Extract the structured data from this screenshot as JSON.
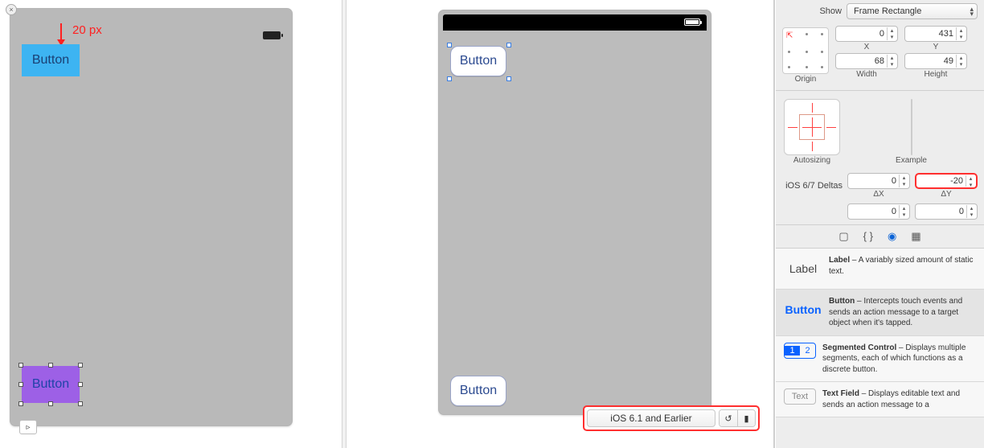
{
  "left_canvas": {
    "annotation_text": "20 px",
    "button_top_label": "Button",
    "button_bottom_label": "Button",
    "segue_glyph": "▹"
  },
  "mid_canvas": {
    "button_top_label": "Button",
    "button_bottom_label": "Button"
  },
  "bottom_bar": {
    "label": "iOS 6.1 and Earlier",
    "seg_left_glyph": "↺",
    "seg_right_glyph": "▮"
  },
  "inspector": {
    "show_label": "Show",
    "show_value": "Frame Rectangle",
    "origin_label": "Origin",
    "coords": {
      "x_label": "X",
      "x_value": "0",
      "y_label": "Y",
      "y_value": "431",
      "w_label": "Width",
      "w_value": "68",
      "h_label": "Height",
      "h_value": "49"
    },
    "autosizing_label": "Autosizing",
    "example_label": "Example",
    "deltas_label": "iOS 6/7 Deltas",
    "deltas": {
      "dx_label": "ΔX",
      "dx_value": "0",
      "dy_label": "ΔY",
      "dy_value": "-20",
      "dw_value": "0",
      "dh_value": "0"
    },
    "library": {
      "label": {
        "thumb": "Label",
        "title": "Label",
        "desc": " – A variably sized amount of static text."
      },
      "button": {
        "thumb": "Button",
        "title": "Button",
        "desc": " – Intercepts touch events and sends an action message to a target object when it's tapped."
      },
      "segmented": {
        "seg1": "1",
        "seg2": "2",
        "title": "Segmented Control",
        "desc": " – Displays multiple segments, each of which functions as a discrete button."
      },
      "textfield": {
        "thumb": "Text",
        "title": "Text Field",
        "desc": " – Displays editable text and sends an action message to a"
      }
    }
  }
}
